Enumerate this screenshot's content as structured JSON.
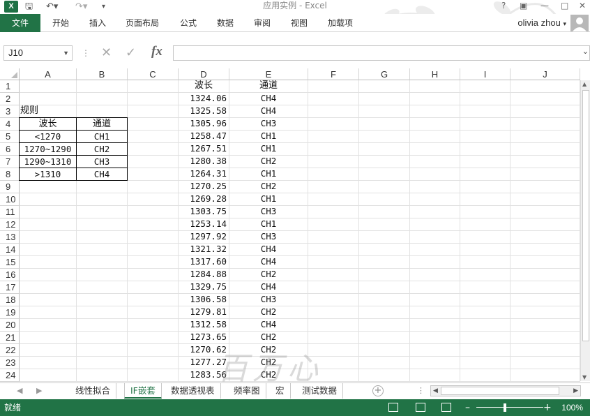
{
  "window": {
    "title": "应用实例 - Excel",
    "help_label": "?",
    "user_name": "olivia zhou"
  },
  "ribbon": {
    "file_label": "文件",
    "tabs": [
      "开始",
      "插入",
      "页面布局",
      "公式",
      "数据",
      "审阅",
      "视图",
      "加载项"
    ]
  },
  "formula_bar": {
    "name_box": "J10",
    "formula": ""
  },
  "sheet": {
    "columns": [
      "A",
      "B",
      "C",
      "D",
      "E",
      "F",
      "G",
      "H",
      "I",
      "J"
    ],
    "rows": [
      "1",
      "2",
      "3",
      "4",
      "5",
      "6",
      "7",
      "8",
      "9",
      "10",
      "11",
      "12",
      "13",
      "14",
      "15",
      "16",
      "17",
      "18",
      "19",
      "20",
      "21",
      "22",
      "23",
      "24"
    ],
    "rules_title": "规则",
    "rules_table": {
      "headers": [
        "波长",
        "通道"
      ],
      "rows": [
        [
          "<1270",
          "CH1"
        ],
        [
          "1270~1290",
          "CH2"
        ],
        [
          "1290~1310",
          "CH3"
        ],
        [
          ">1310",
          "CH4"
        ]
      ]
    },
    "data_headers": [
      "波长",
      "通道"
    ],
    "data_rows": [
      [
        "1324.06",
        "CH4"
      ],
      [
        "1325.58",
        "CH4"
      ],
      [
        "1305.96",
        "CH3"
      ],
      [
        "1258.47",
        "CH1"
      ],
      [
        "1267.51",
        "CH1"
      ],
      [
        "1280.38",
        "CH2"
      ],
      [
        "1264.31",
        "CH1"
      ],
      [
        "1270.25",
        "CH2"
      ],
      [
        "1269.28",
        "CH1"
      ],
      [
        "1303.75",
        "CH3"
      ],
      [
        "1253.14",
        "CH1"
      ],
      [
        "1297.92",
        "CH3"
      ],
      [
        "1321.32",
        "CH4"
      ],
      [
        "1317.60",
        "CH4"
      ],
      [
        "1284.88",
        "CH2"
      ],
      [
        "1329.75",
        "CH4"
      ],
      [
        "1306.58",
        "CH3"
      ],
      [
        "1279.81",
        "CH2"
      ],
      [
        "1312.58",
        "CH4"
      ],
      [
        "1273.65",
        "CH2"
      ],
      [
        "1270.62",
        "CH2"
      ],
      [
        "1277.27",
        "CH2"
      ],
      [
        "1283.56",
        "CH2"
      ]
    ]
  },
  "sheet_tabs": [
    "线性拟合",
    "IF嵌套",
    "数据透视表",
    "频率图",
    "宏",
    "测试数据"
  ],
  "active_tab": "IF嵌套",
  "status": {
    "ready": "就绪",
    "zoom": "100%"
  },
  "watermark": "百万心",
  "colors": {
    "accent": "#217346",
    "status_bar": "#217346"
  }
}
